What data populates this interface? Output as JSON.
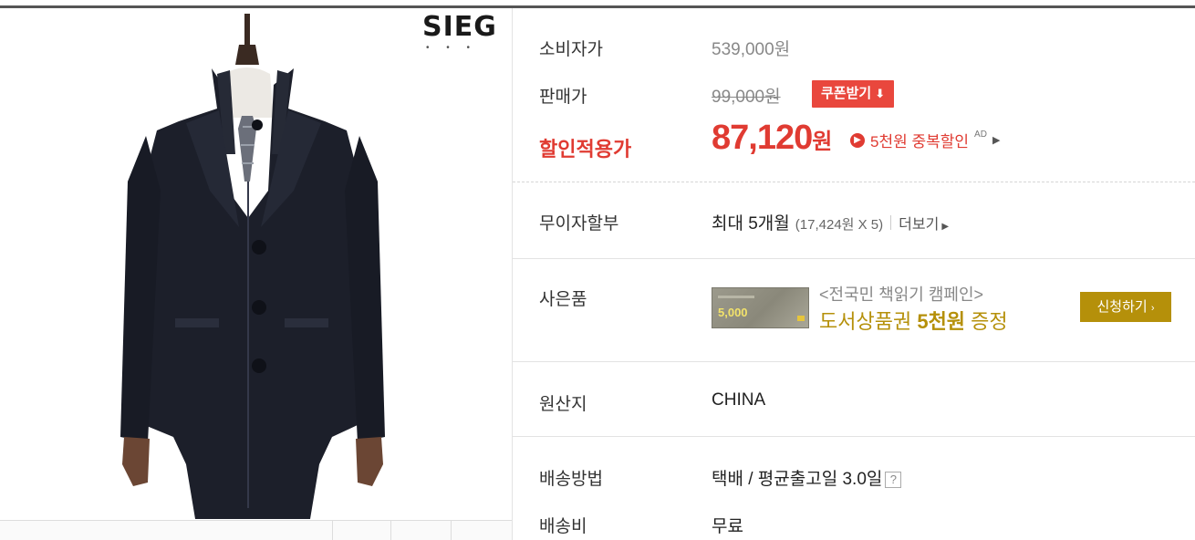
{
  "brand": {
    "logo_text": "SIEG",
    "logo_dots": "• • •"
  },
  "product_image": {
    "icon": "coat-product-image",
    "colors": {
      "coat": "#1c1f2a",
      "shirt": "#ece9e4",
      "tie": "#6b6f7a",
      "stand": "#3a2a22"
    }
  },
  "price": {
    "consumer_label": "소비자가",
    "consumer_value": "539,000원",
    "sale_label": "판매가",
    "sale_value": "99,000원",
    "coupon_button": "쿠폰받기",
    "discount_label": "할인적용가",
    "discount_amount": "87,120",
    "discount_unit": "원",
    "dup_discount_text": "5천원 중복할인",
    "dup_discount_ad": "AD"
  },
  "installment": {
    "label": "무이자할부",
    "value": "최대 5개월",
    "detail": "(17,424원 X 5)",
    "more": "더보기"
  },
  "gift": {
    "label": "사은품",
    "voucher_amount": "5,000",
    "line1": "<전국민 책읽기 캠페인>",
    "line2_prefix": "도서상품권 ",
    "line2_bold": "5천원",
    "line2_suffix": " 증정",
    "apply_button": "신청하기"
  },
  "origin": {
    "label": "원산지",
    "value": "CHINA"
  },
  "shipping": {
    "method_label": "배송방법",
    "method_value": "택배 / 평균출고일 3.0일",
    "help": "?",
    "fee_label": "배송비",
    "fee_value": "무료"
  },
  "colors": {
    "accent_red": "#e03b32",
    "coupon_red": "#e9473d",
    "gold": "#b5900a"
  }
}
